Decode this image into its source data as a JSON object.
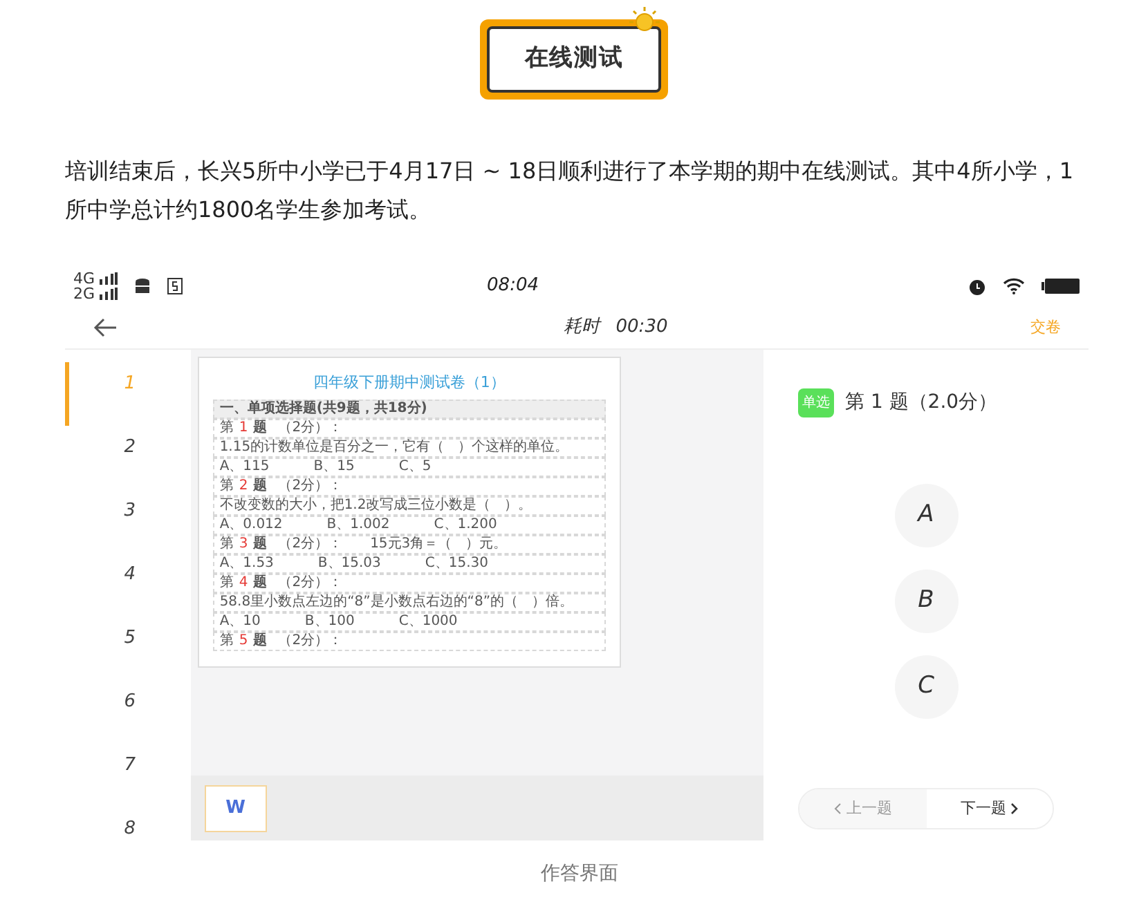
{
  "badge": {
    "title": "在线测试"
  },
  "paragraph": "培训结束后，长兴5所中小学已于4月17日 ~ 18日顺利进行了本学期的期中在线测试。其中4所小学，1所中学总计约1800名学生参加考试。",
  "phone": {
    "status_bar": {
      "networks": [
        "4G",
        "2G"
      ],
      "time": "08:04"
    },
    "nav": {
      "timer_label": "耗时",
      "timer": "00:30",
      "submit": "交卷"
    },
    "sidebar": {
      "items": [
        {
          "label": "1",
          "selected": true
        },
        {
          "label": "2",
          "selected": false
        },
        {
          "label": "3",
          "selected": false
        },
        {
          "label": "4",
          "selected": false
        },
        {
          "label": "5",
          "selected": false
        },
        {
          "label": "6",
          "selected": false
        },
        {
          "label": "7",
          "selected": false
        },
        {
          "label": "8",
          "selected": false
        }
      ]
    },
    "document": {
      "title": "四年级下册期中测试卷（1）",
      "rows": [
        {
          "kind": "section",
          "text": "一、单项选择题(共9题，共18分)"
        },
        {
          "kind": "question",
          "prefix": "第",
          "number": "1",
          "suffix": "题",
          "points": "（2分）："
        },
        {
          "kind": "text",
          "text": "1.15的计数单位是百分之一，它有（　）个这样的单位。"
        },
        {
          "kind": "options",
          "options": [
            "A、115",
            "B、15",
            "C、5"
          ]
        },
        {
          "kind": "question",
          "prefix": "第",
          "number": "2",
          "suffix": "题",
          "points": "（2分）："
        },
        {
          "kind": "text",
          "text": "不改变数的大小，把1.2改写成三位小数是（　）。"
        },
        {
          "kind": "options",
          "options": [
            "A、0.012",
            "B、1.002",
            "C、1.200"
          ]
        },
        {
          "kind": "question",
          "prefix": "第",
          "number": "3",
          "suffix": "题",
          "points": "（2分）：",
          "extra": "15元3角＝（　）元。"
        },
        {
          "kind": "options",
          "options": [
            "A、1.53",
            "B、15.03",
            "C、15.30"
          ]
        },
        {
          "kind": "question",
          "prefix": "第",
          "number": "4",
          "suffix": "题",
          "points": "（2分）："
        },
        {
          "kind": "text",
          "text": "58.8里小数点左边的“8”是小数点右边的“8”的（　）倍。"
        },
        {
          "kind": "options",
          "options": [
            "A、10",
            "B、100",
            "C、1000"
          ]
        },
        {
          "kind": "question",
          "prefix": "第",
          "number": "5",
          "suffix": "题",
          "points": "（2分）："
        }
      ]
    },
    "attachment": {
      "label": "W"
    },
    "question": {
      "type_tag": "单选",
      "title": "第 1 题（2.0分）",
      "options": [
        {
          "label": "A",
          "selected": false
        },
        {
          "label": "B",
          "selected": false
        },
        {
          "label": "C",
          "selected": false
        }
      ]
    },
    "pager": [
      {
        "label": "上一题",
        "disabled": true,
        "kind": "prev"
      },
      {
        "label": "下一题",
        "disabled": false,
        "kind": "next"
      }
    ]
  },
  "caption": "作答界面"
}
